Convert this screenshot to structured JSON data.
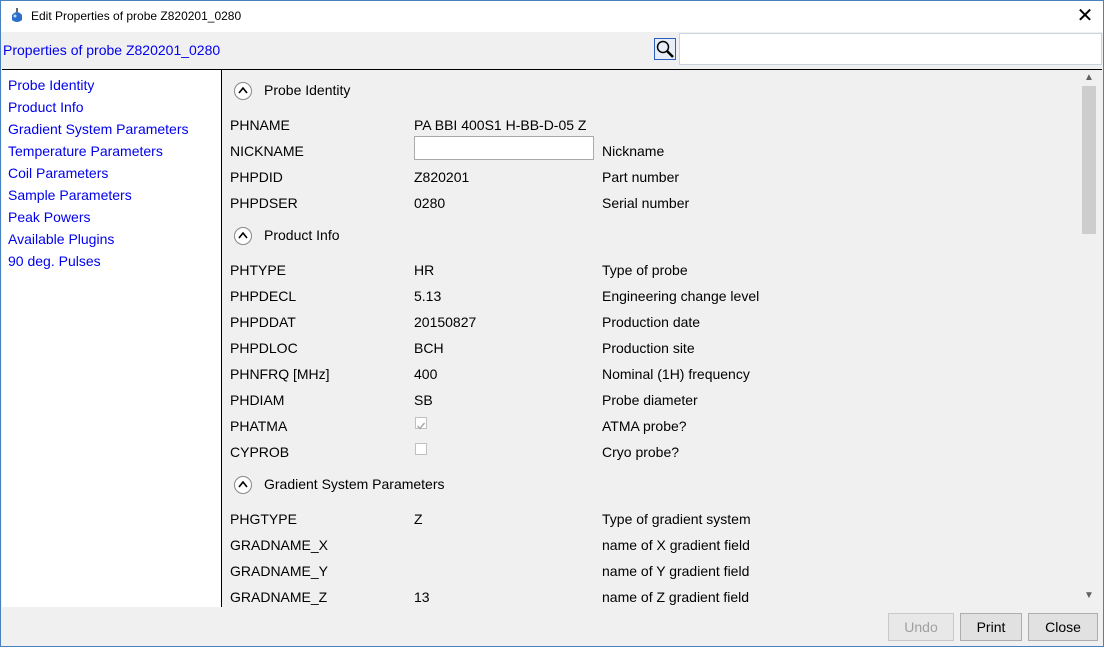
{
  "window": {
    "title": "Edit Properties of probe  Z820201_0280"
  },
  "header": {
    "props_title": "Properties of probe  Z820201_0280",
    "search_placeholder": ""
  },
  "sidebar": {
    "items": [
      {
        "label": "Probe Identity"
      },
      {
        "label": "Product Info"
      },
      {
        "label": "Gradient System Parameters"
      },
      {
        "label": "Temperature Parameters"
      },
      {
        "label": "Coil Parameters"
      },
      {
        "label": "Sample Parameters"
      },
      {
        "label": "Peak Powers"
      },
      {
        "label": "Available Plugins"
      },
      {
        "label": "90 deg. Pulses"
      }
    ]
  },
  "sections": {
    "identity": {
      "title": "Probe Identity",
      "rows": [
        {
          "name": "PHNAME",
          "value": "PA BBI 400S1 H-BB-D-05 Z",
          "desc": ""
        },
        {
          "name": "NICKNAME",
          "value": "",
          "desc": "Nickname"
        },
        {
          "name": "PHPDID",
          "value": "Z820201",
          "desc": "Part number"
        },
        {
          "name": "PHPDSER",
          "value": "0280",
          "desc": "Serial number"
        }
      ]
    },
    "product": {
      "title": "Product Info",
      "rows": [
        {
          "name": "PHTYPE",
          "value": "HR",
          "desc": "Type of probe"
        },
        {
          "name": "PHPDECL",
          "value": "5.13",
          "desc": "Engineering change level"
        },
        {
          "name": "PHPDDAT",
          "value": "20150827",
          "desc": "Production date"
        },
        {
          "name": "PHPDLOC",
          "value": "BCH",
          "desc": "Production site"
        },
        {
          "name": "PHNFRQ [MHz]",
          "value": "400",
          "desc": "Nominal (1H) frequency"
        },
        {
          "name": "PHDIAM",
          "value": "SB",
          "desc": "Probe diameter"
        },
        {
          "name": "PHATMA",
          "checked": true,
          "desc": "ATMA probe?"
        },
        {
          "name": "CYPROB",
          "checked": false,
          "desc": "Cryo probe?"
        }
      ]
    },
    "gradient": {
      "title": "Gradient System Parameters",
      "rows": [
        {
          "name": "PHGTYPE",
          "value": "Z",
          "desc": "Type of gradient system"
        },
        {
          "name": "GRADNAME_X",
          "value": "",
          "desc": "name of X gradient field"
        },
        {
          "name": "GRADNAME_Y",
          "value": "",
          "desc": "name of Y gradient field"
        },
        {
          "name": "GRADNAME_Z",
          "value": "13",
          "desc": "name of Z gradient field"
        }
      ]
    }
  },
  "buttons": {
    "undo": "Undo",
    "print": "Print",
    "close": "Close"
  },
  "colors": {
    "link": "#0000ee",
    "border": "#4a7fc0"
  }
}
